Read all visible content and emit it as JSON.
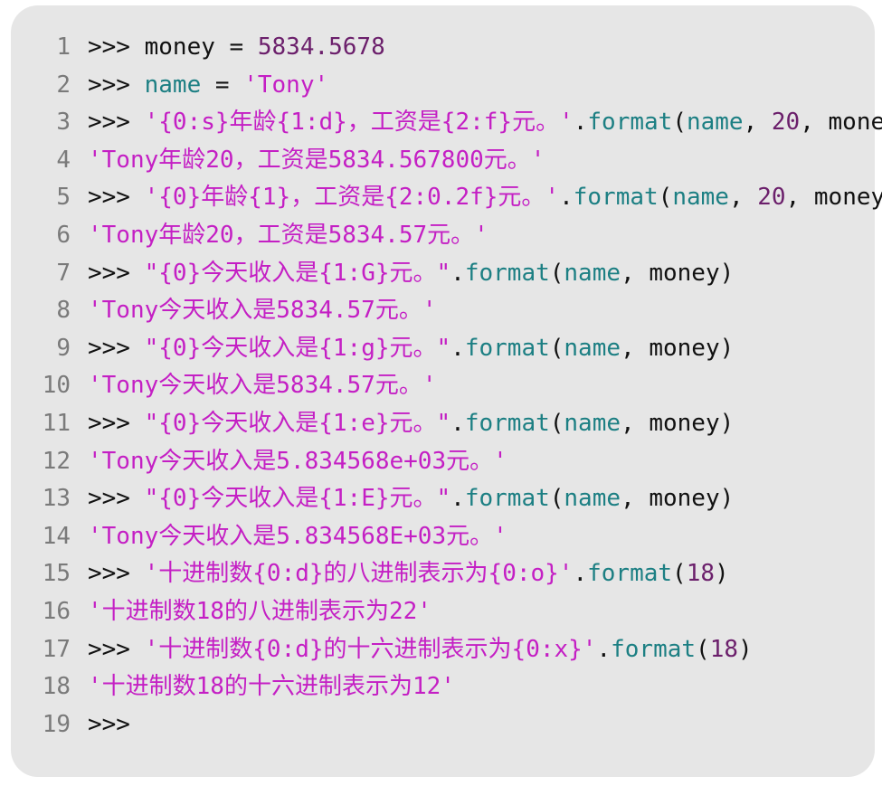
{
  "panel": {
    "background": "#e6e6e6",
    "colors": {
      "string": "#c41fc4",
      "identifier": "#1c7f83",
      "number": "#6b1f6b",
      "plain": "#111111",
      "line_number": "#7a7a7a"
    }
  },
  "lines": [
    {
      "num": "1",
      "tokens": [
        {
          "t": "prompt",
          "v": ">>> "
        },
        {
          "t": "plain",
          "v": "money = "
        },
        {
          "t": "number",
          "v": "5834.5678"
        }
      ]
    },
    {
      "num": "2",
      "tokens": [
        {
          "t": "prompt",
          "v": ">>> "
        },
        {
          "t": "ident",
          "v": "name"
        },
        {
          "t": "plain",
          "v": " = "
        },
        {
          "t": "string",
          "v": "'Tony'"
        }
      ]
    },
    {
      "num": "3",
      "tokens": [
        {
          "t": "prompt",
          "v": ">>> "
        },
        {
          "t": "string",
          "v": "'{0:s}年龄{1:d}，工资是{2:f}元。'"
        },
        {
          "t": "plain",
          "v": "."
        },
        {
          "t": "method",
          "v": "format"
        },
        {
          "t": "plain",
          "v": "("
        },
        {
          "t": "ident",
          "v": "name"
        },
        {
          "t": "plain",
          "v": ", "
        },
        {
          "t": "number",
          "v": "20"
        },
        {
          "t": "plain",
          "v": ", money)"
        }
      ]
    },
    {
      "num": "4",
      "tokens": [
        {
          "t": "output",
          "v": "'Tony年龄20，工资是5834.567800元。'"
        }
      ]
    },
    {
      "num": "5",
      "tokens": [
        {
          "t": "prompt",
          "v": ">>> "
        },
        {
          "t": "string",
          "v": "'{0}年龄{1}，工资是{2:0.2f}元。'"
        },
        {
          "t": "plain",
          "v": "."
        },
        {
          "t": "method",
          "v": "format"
        },
        {
          "t": "plain",
          "v": "("
        },
        {
          "t": "ident",
          "v": "name"
        },
        {
          "t": "plain",
          "v": ", "
        },
        {
          "t": "number",
          "v": "20"
        },
        {
          "t": "plain",
          "v": ", money)"
        }
      ]
    },
    {
      "num": "6",
      "tokens": [
        {
          "t": "output",
          "v": "'Tony年龄20，工资是5834.57元。'"
        }
      ]
    },
    {
      "num": "7",
      "tokens": [
        {
          "t": "prompt",
          "v": ">>> "
        },
        {
          "t": "string",
          "v": "\"{0}今天收入是{1:G}元。\""
        },
        {
          "t": "plain",
          "v": "."
        },
        {
          "t": "method",
          "v": "format"
        },
        {
          "t": "plain",
          "v": "("
        },
        {
          "t": "ident",
          "v": "name"
        },
        {
          "t": "plain",
          "v": ", money)"
        }
      ]
    },
    {
      "num": "8",
      "tokens": [
        {
          "t": "output",
          "v": "'Tony今天收入是5834.57元。'"
        }
      ]
    },
    {
      "num": "9",
      "tokens": [
        {
          "t": "prompt",
          "v": ">>> "
        },
        {
          "t": "string",
          "v": "\"{0}今天收入是{1:g}元。\""
        },
        {
          "t": "plain",
          "v": "."
        },
        {
          "t": "method",
          "v": "format"
        },
        {
          "t": "plain",
          "v": "("
        },
        {
          "t": "ident",
          "v": "name"
        },
        {
          "t": "plain",
          "v": ", money)"
        }
      ]
    },
    {
      "num": "10",
      "tokens": [
        {
          "t": "output",
          "v": "'Tony今天收入是5834.57元。'"
        }
      ]
    },
    {
      "num": "11",
      "tokens": [
        {
          "t": "prompt",
          "v": ">>> "
        },
        {
          "t": "string",
          "v": "\"{0}今天收入是{1:e}元。\""
        },
        {
          "t": "plain",
          "v": "."
        },
        {
          "t": "method",
          "v": "format"
        },
        {
          "t": "plain",
          "v": "("
        },
        {
          "t": "ident",
          "v": "name"
        },
        {
          "t": "plain",
          "v": ", money)"
        }
      ]
    },
    {
      "num": "12",
      "tokens": [
        {
          "t": "output",
          "v": "'Tony今天收入是5.834568e+03元。'"
        }
      ]
    },
    {
      "num": "13",
      "tokens": [
        {
          "t": "prompt",
          "v": ">>> "
        },
        {
          "t": "string",
          "v": "\"{0}今天收入是{1:E}元。\""
        },
        {
          "t": "plain",
          "v": "."
        },
        {
          "t": "method",
          "v": "format"
        },
        {
          "t": "plain",
          "v": "("
        },
        {
          "t": "ident",
          "v": "name"
        },
        {
          "t": "plain",
          "v": ", money)"
        }
      ]
    },
    {
      "num": "14",
      "tokens": [
        {
          "t": "output",
          "v": "'Tony今天收入是5.834568E+03元。'"
        }
      ]
    },
    {
      "num": "15",
      "tokens": [
        {
          "t": "prompt",
          "v": ">>> "
        },
        {
          "t": "string",
          "v": "'十进制数{0:d}的八进制表示为{0:o}'"
        },
        {
          "t": "plain",
          "v": "."
        },
        {
          "t": "method",
          "v": "format"
        },
        {
          "t": "plain",
          "v": "("
        },
        {
          "t": "number",
          "v": "18"
        },
        {
          "t": "plain",
          "v": ")"
        }
      ]
    },
    {
      "num": "16",
      "tokens": [
        {
          "t": "output",
          "v": "'十进制数18的八进制表示为22'"
        }
      ]
    },
    {
      "num": "17",
      "tokens": [
        {
          "t": "prompt",
          "v": ">>> "
        },
        {
          "t": "string",
          "v": "'十进制数{0:d}的十六进制表示为{0:x}'"
        },
        {
          "t": "plain",
          "v": "."
        },
        {
          "t": "method",
          "v": "format"
        },
        {
          "t": "plain",
          "v": "("
        },
        {
          "t": "number",
          "v": "18"
        },
        {
          "t": "plain",
          "v": ")"
        }
      ]
    },
    {
      "num": "18",
      "tokens": [
        {
          "t": "output",
          "v": "'十进制数18的十六进制表示为12'"
        }
      ]
    },
    {
      "num": "19",
      "tokens": [
        {
          "t": "prompt",
          "v": ">>>"
        }
      ]
    }
  ]
}
